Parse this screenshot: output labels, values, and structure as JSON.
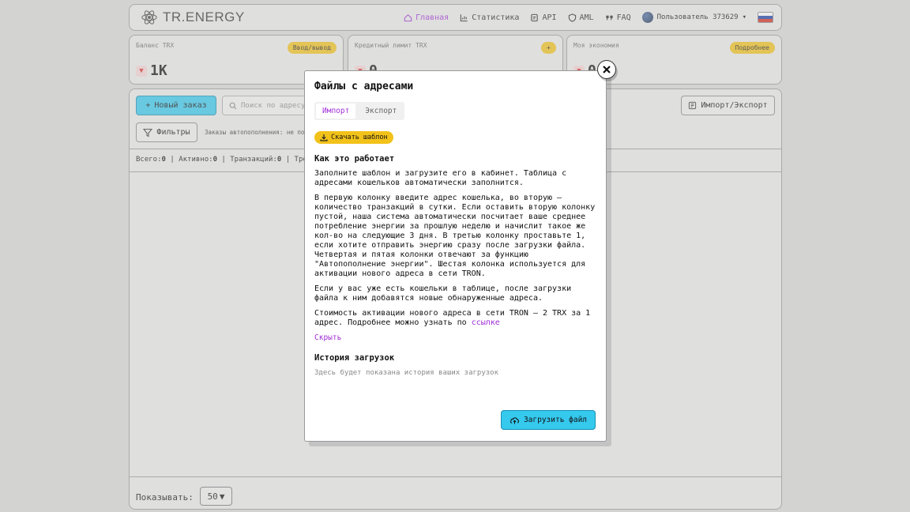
{
  "header": {
    "logo_text": "TR.ENERGY",
    "nav": [
      {
        "label": "Главная",
        "icon": "home-icon",
        "active": true
      },
      {
        "label": "Статистика",
        "icon": "chart-icon",
        "active": false
      },
      {
        "label": "API",
        "icon": "api-icon",
        "active": false
      },
      {
        "label": "AML",
        "icon": "shield-icon",
        "active": false
      },
      {
        "label": "FAQ",
        "icon": "quote-icon",
        "active": false
      }
    ],
    "user_label": "Пользователь 373629"
  },
  "stats": [
    {
      "label": "Баланс TRX",
      "button": "Ввод/вывод",
      "value": "1K"
    },
    {
      "label": "Кредитный лимит TRX",
      "button": "+",
      "value": "0"
    },
    {
      "label": "Моя экономия",
      "button": "Подробнее",
      "value": "0"
    }
  ],
  "toolbar": {
    "new_order": "Новый заказ",
    "search_placeholder": "Поиск по адресу",
    "import_export": "Импорт/Экспорт",
    "filters": "Фильтры",
    "auto_note": "Заказы автопополнения: не пока"
  },
  "counters": {
    "total_label": "Всего:",
    "total": "0",
    "active_label": "Активно:",
    "active": "0",
    "tx_label": "Транзакций:",
    "tx": "0",
    "req_label": "Требу"
  },
  "footer": {
    "show_label": "Показывать:",
    "page_size": "50"
  },
  "modal": {
    "title": "Файлы с адресами",
    "tabs": [
      "Импорт",
      "Экспорт"
    ],
    "template_button": "Скачать шаблон",
    "how_title": "Как это работает",
    "p1": "Заполните шаблон и загрузите его в кабинет. Таблица с адресами кошельков автоматически заполнится.",
    "p2": "В первую колонку введите адрес кошелька, во вторую — количество транзакций в сутки. Если оставить вторую колонку пустой, наша система автоматически посчитает ваше среднее потребление энергии за прошлую неделю и начислит такое же кол-во на следующие 3 дня. В третью колонку проставьте 1, если хотите отправить энергию сразу после загрузки файла. Четвертая и пятая колонки отвечают за функцию \"Автопополнение энергии\". Шестая колонка используется для активации нового адреса в сети TRON.",
    "p3": "Если у вас уже есть кошельки в таблице, после загрузки файла к ним добавятся новые обнаруженные адреса.",
    "p4": "Стоимость активации нового адреса в сети TRON – 2 TRX за 1 адрес. Подробнее можно узнать по",
    "p4_link": "ссылке",
    "hide": "Скрыть",
    "history_title": "История загрузок",
    "history_empty": "Здесь будет показана история ваших загрузок",
    "upload_button": "Загрузить файл"
  }
}
